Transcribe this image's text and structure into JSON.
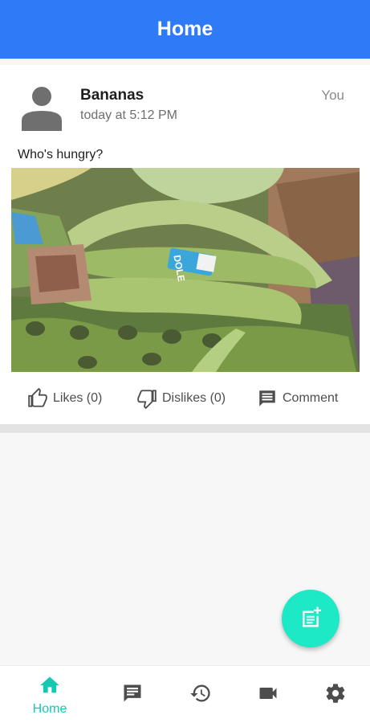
{
  "header": {
    "title": "Home"
  },
  "post": {
    "author": "Bananas",
    "timestamp": "today at 5:12 PM",
    "owner": "You",
    "caption": "Who's hungry?",
    "image_icon": "photo-of-bananas",
    "sticker_text": "DOLE"
  },
  "actions": {
    "likes_label": "Likes (0)",
    "dislikes_label": "Dislikes (0)",
    "comment_label": "Comment"
  },
  "fab": {
    "icon": "new-post-icon"
  },
  "nav": {
    "items": [
      {
        "label": "Home",
        "icon": "home-icon",
        "active": true
      },
      {
        "label": "",
        "icon": "chat-icon",
        "active": false
      },
      {
        "label": "",
        "icon": "history-icon",
        "active": false
      },
      {
        "label": "",
        "icon": "video-camera-icon",
        "active": false
      },
      {
        "label": "",
        "icon": "settings-icon",
        "active": false
      }
    ]
  },
  "colors": {
    "app_bar": "#2f7af6",
    "fab": "#1de9c6",
    "nav_active": "#14c8b4",
    "icon_gray": "#4d4d4d"
  }
}
